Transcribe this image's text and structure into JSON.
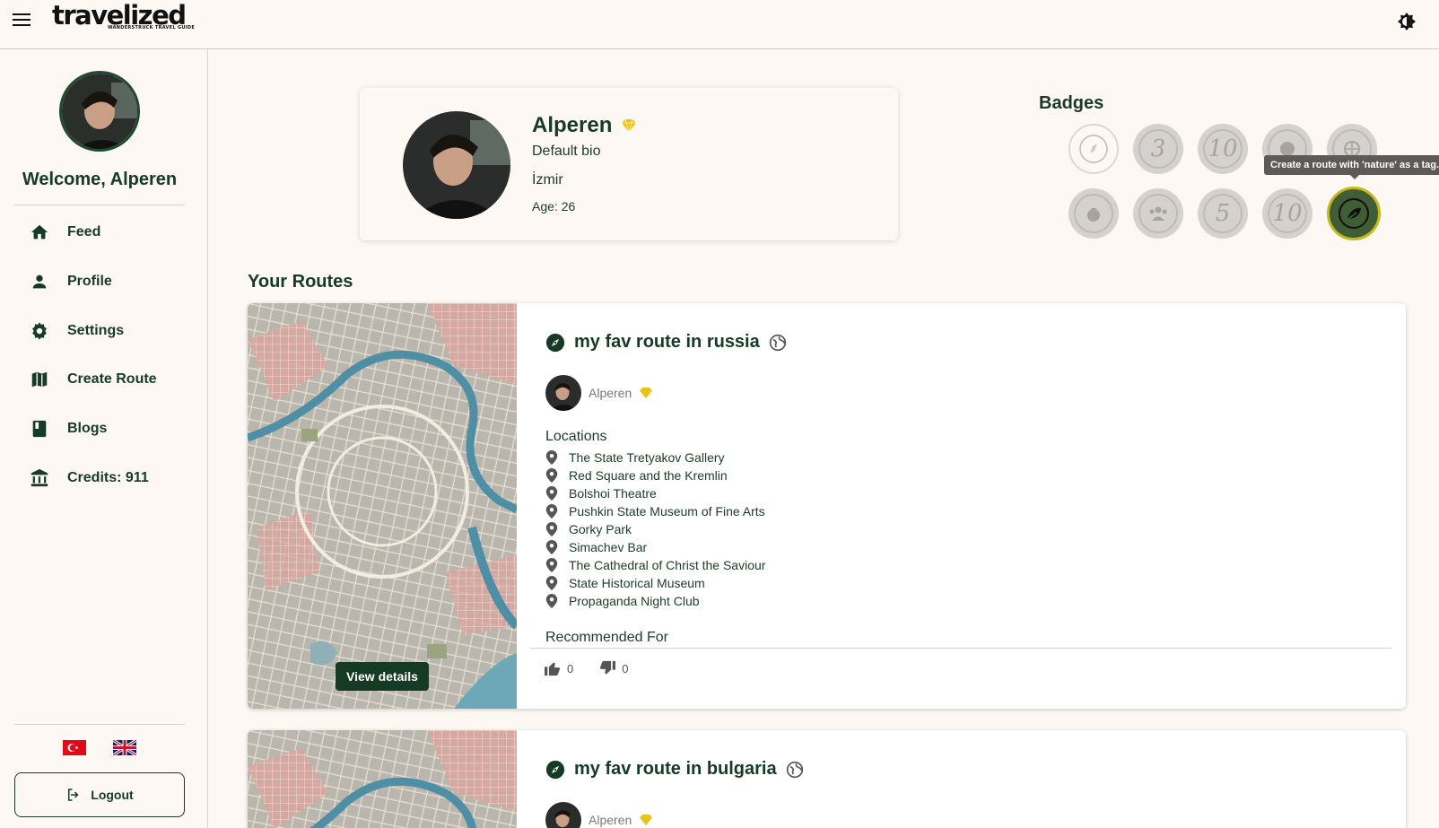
{
  "app": {
    "logo_text": "travelized",
    "logo_tagline": "WANDERSTRUCK TRAVEL GUIDE",
    "brand_color": "#163b24"
  },
  "sidebar": {
    "welcome": "Welcome, Alperen",
    "items": [
      {
        "label": "Feed",
        "icon": "home-icon"
      },
      {
        "label": "Profile",
        "icon": "person-icon"
      },
      {
        "label": "Settings",
        "icon": "gear-icon"
      },
      {
        "label": "Create Route",
        "icon": "map-icon"
      },
      {
        "label": "Blogs",
        "icon": "book-icon"
      },
      {
        "label": "Credits: 911",
        "icon": "bank-icon"
      }
    ],
    "logout_label": "Logout"
  },
  "profile": {
    "name": "Alperen",
    "bio": "Default bio",
    "city": "İzmir",
    "age": "Age: 26"
  },
  "badges": {
    "title": "Badges",
    "tooltip": "Create a route with 'nature' as a tag.",
    "row1": [
      "",
      "3",
      "10",
      "",
      ""
    ],
    "row2": [
      "",
      "",
      "5",
      "10",
      ""
    ]
  },
  "routes": {
    "title": "Your Routes",
    "cards": [
      {
        "title": "my fav route in russia",
        "author": "Alperen",
        "locations_label": "Locations",
        "locations": [
          "The State Tretyakov Gallery",
          "Red Square and the Kremlin",
          "Bolshoi Theatre",
          "Pushkin State Museum of Fine Arts",
          "Gorky Park",
          "Simachev Bar",
          "The Cathedral of Christ the Saviour",
          "State Historical Museum",
          "Propaganda Night Club"
        ],
        "recommended_label": "Recommended For",
        "likes": "0",
        "dislikes": "0",
        "view_details": "View details"
      },
      {
        "title": "my fav route in bulgaria",
        "author": "Alperen"
      }
    ]
  }
}
